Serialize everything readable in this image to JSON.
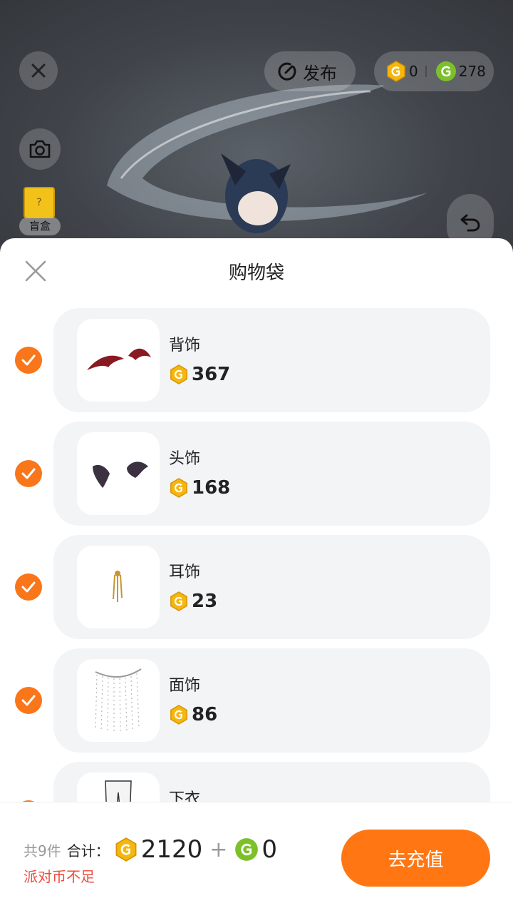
{
  "top_bar": {
    "publish_label": "发布",
    "balance_gold": "0",
    "balance_green": "278"
  },
  "side": {
    "blind_box_label": "盲盒"
  },
  "sheet": {
    "title": "购物袋",
    "items": [
      {
        "name": "背饰",
        "price": "367",
        "checked": true
      },
      {
        "name": "头饰",
        "price": "168",
        "checked": true
      },
      {
        "name": "耳饰",
        "price": "23",
        "checked": true
      },
      {
        "name": "面饰",
        "price": "86",
        "checked": true
      },
      {
        "name": "下衣",
        "price": "",
        "checked": true
      }
    ]
  },
  "footer": {
    "count_text": "共9件",
    "total_label": "合计：",
    "total_gold": "2120",
    "plus": "+",
    "total_green": "0",
    "warning": "派对币不足",
    "recharge_label": "去充值"
  },
  "colors": {
    "accent": "#ff7612",
    "gold_coin": "#f5b60e",
    "green_coin": "#7cc02a",
    "warning": "#f04a3a"
  }
}
